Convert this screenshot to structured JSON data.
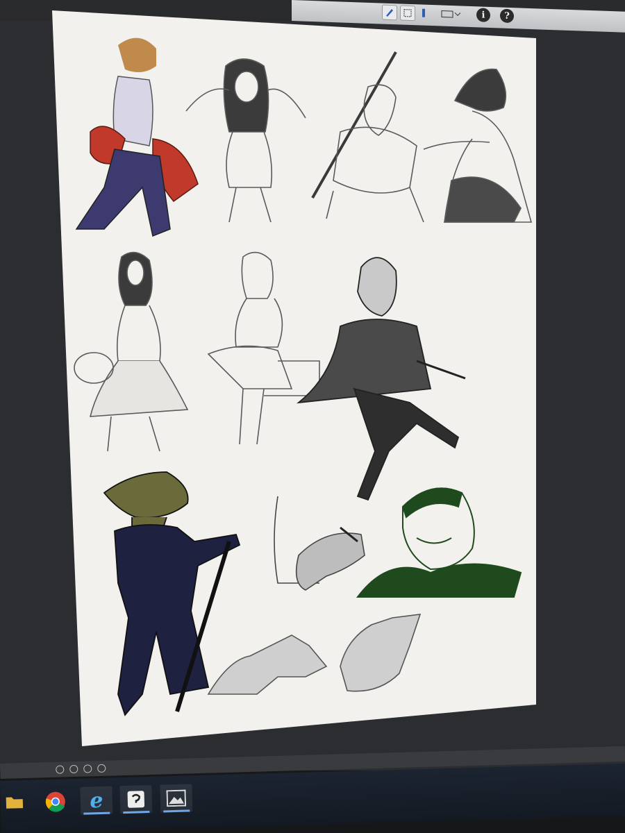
{
  "toolbar": {
    "info_label": "i",
    "help_label": "?",
    "icons": [
      "pen-tool-icon",
      "selection-tool-icon",
      "layer-icon",
      "dropdown-icon",
      "info-icon",
      "help-icon"
    ]
  },
  "canvas": {
    "background": "#f2f1ee",
    "accent_colors": {
      "jacket_red": "#c0392b",
      "jeans_blue": "#3c3a6e",
      "suit_navy": "#1e2140",
      "scale_green": "#6b6a3a",
      "marker_green": "#1f4a1d",
      "ink_gray": "#5a5a5a"
    },
    "sketches": [
      "girl-red-jacket-sketch",
      "girl-hands-hair-sketch",
      "swordsman-sketch",
      "bob-hair-girl-sketch",
      "girl-holding-hat-sketch",
      "seated-girl-sketch",
      "helmet-man-coat-sketch",
      "lizard-head-suit-sketch",
      "hand-cigarette-sketch",
      "smiling-man-portrait-sketch",
      "hand-study-left-sketch",
      "hand-study-right-sketch"
    ]
  },
  "taskbar": {
    "items": [
      {
        "name": "file-explorer",
        "icon": "folder-icon"
      },
      {
        "name": "chrome",
        "icon": "chrome-icon"
      },
      {
        "name": "internet-explorer",
        "icon": "ie-icon",
        "glyph": "e"
      },
      {
        "name": "clip-studio",
        "icon": "clip-studio-icon"
      },
      {
        "name": "photos",
        "icon": "photos-icon"
      }
    ]
  }
}
